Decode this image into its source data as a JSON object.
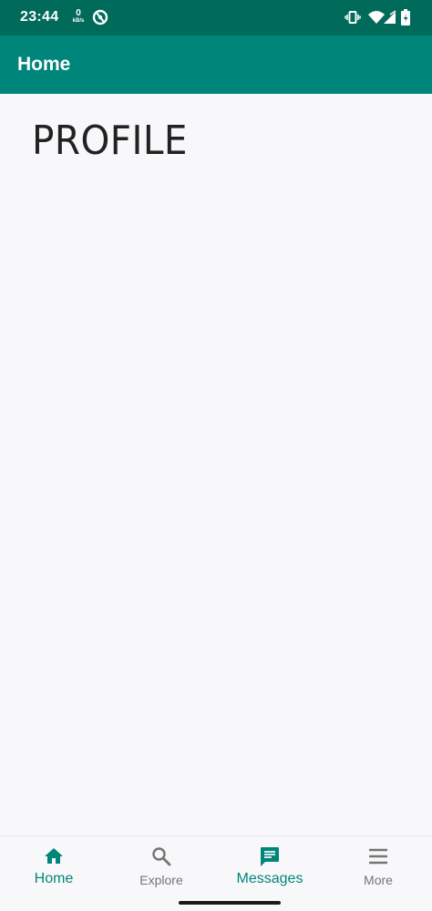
{
  "status_bar": {
    "time": "23:44",
    "net_speed_value": "0",
    "net_speed_unit": "kB/s",
    "icons": [
      "data-saver-icon",
      "vibrate-icon",
      "wifi-icon",
      "signal-icon",
      "battery-icon"
    ]
  },
  "app_bar": {
    "title": "Home"
  },
  "content": {
    "heading": "PROFILE"
  },
  "bottom_nav": {
    "items": [
      {
        "label": "Home",
        "icon": "home-icon",
        "active": true
      },
      {
        "label": "Explore",
        "icon": "search-icon",
        "active": false
      },
      {
        "label": "Messages",
        "icon": "message-icon",
        "active": true
      },
      {
        "label": "More",
        "icon": "menu-icon",
        "active": false
      }
    ]
  },
  "colors": {
    "status_bar": "#006a5b",
    "app_bar": "#00857a",
    "accent": "#00857a",
    "inactive": "#757575",
    "background": "#f8f8fa"
  }
}
